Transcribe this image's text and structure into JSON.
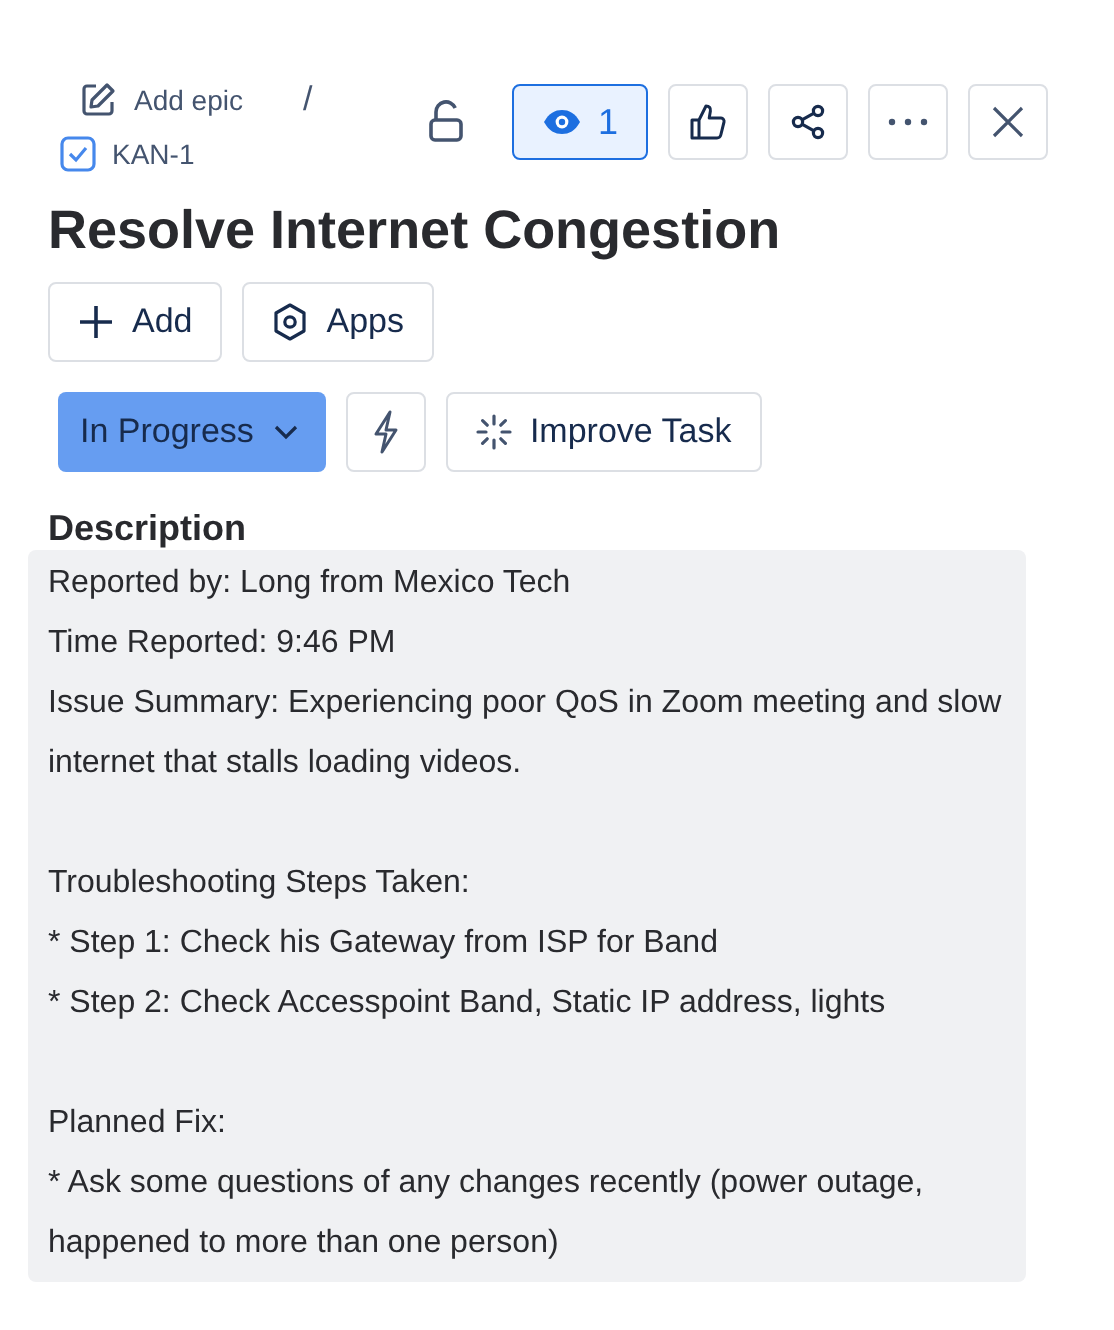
{
  "breadcrumb": {
    "add_epic": "Add epic",
    "separator": "/",
    "issue_key": "KAN-1"
  },
  "toolbar": {
    "locked": false,
    "watch": {
      "count": "1",
      "watching": true
    }
  },
  "title": "Resolve Internet Congestion",
  "actions": [
    {
      "label": "Add",
      "kind": "add"
    },
    {
      "label": "Apps",
      "kind": "apps"
    }
  ],
  "status": {
    "label": "In Progress"
  },
  "improve": {
    "label": "Improve Task"
  },
  "description": {
    "heading": "Description",
    "paragraphs": [
      {
        "lines": [
          "Reported by: Long from Mexico Tech",
          "Time Reported: 9:46 PM",
          "Issue Summary: Experiencing poor QoS in Zoom meeting and slow internet that stalls loading videos."
        ]
      },
      {
        "lines": [
          "Troubleshooting Steps Taken:",
          "* Step 1: Check his Gateway from ISP for Band",
          "* Step 2: Check Accesspoint Band, Static IP address, lights"
        ]
      },
      {
        "lines": [
          "Planned Fix:",
          "* Ask some questions of any changes recently (power outage, happened to more than one person)"
        ]
      }
    ]
  }
}
